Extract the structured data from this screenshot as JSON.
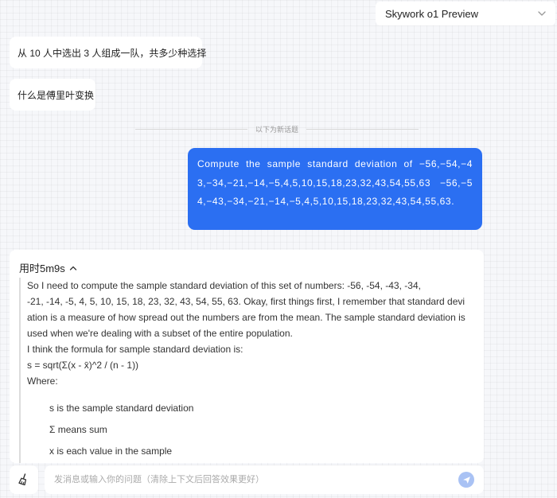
{
  "header": {
    "model_selector": "Skywork o1 Preview",
    "icons": {
      "dropdown": "chevron-down-icon"
    }
  },
  "history": {
    "questions": [
      "从 10 人中选出 3 人组成一队，共多少种选择",
      "什么是傅里叶变换"
    ],
    "divider_text": "以下为新话题"
  },
  "current_question": "Compute the sample standard deviation of −56,−54,−43,−34,−21,−14,−5,4,5,10,15,18,23,32,43,54,55,63 −56,−54,−43,−34,−21,−14,−5,4,5,10,15,18,23,32,43,54,55,63.",
  "answer": {
    "elapsed_label": "用时5m9s",
    "toggle_icon": "chevron-up-icon",
    "paragraph1_line1": "So I need to compute the sample standard deviation of this set of numbers: -56, -54, -43, -34,",
    "paragraph1_rest": "-21, -14, -5, 4, 5, 10, 15, 18, 23, 32, 43, 54, 55, 63. Okay, first things first, I remember that standard deviation is a measure of how spread out the numbers are from the mean. The sample standard deviation is used when we're dealing with a subset of the entire population.",
    "paragraph2": "I think the formula for sample standard deviation is:",
    "formula": "s = sqrt(Σ(x - x̄)^2 / (n - 1))",
    "where_label": "Where:",
    "bullets": [
      "s is the sample standard deviation",
      "Σ means sum",
      "x is each value in the sample"
    ]
  },
  "composer": {
    "placeholder": "发消息或输入你的问题（清除上下文后回答效果更好）",
    "value": "",
    "icons": {
      "clear": "broom-icon",
      "send": "send-icon"
    }
  },
  "colors": {
    "accent": "#2b6ff2",
    "send_button": "#a9c2f4"
  }
}
